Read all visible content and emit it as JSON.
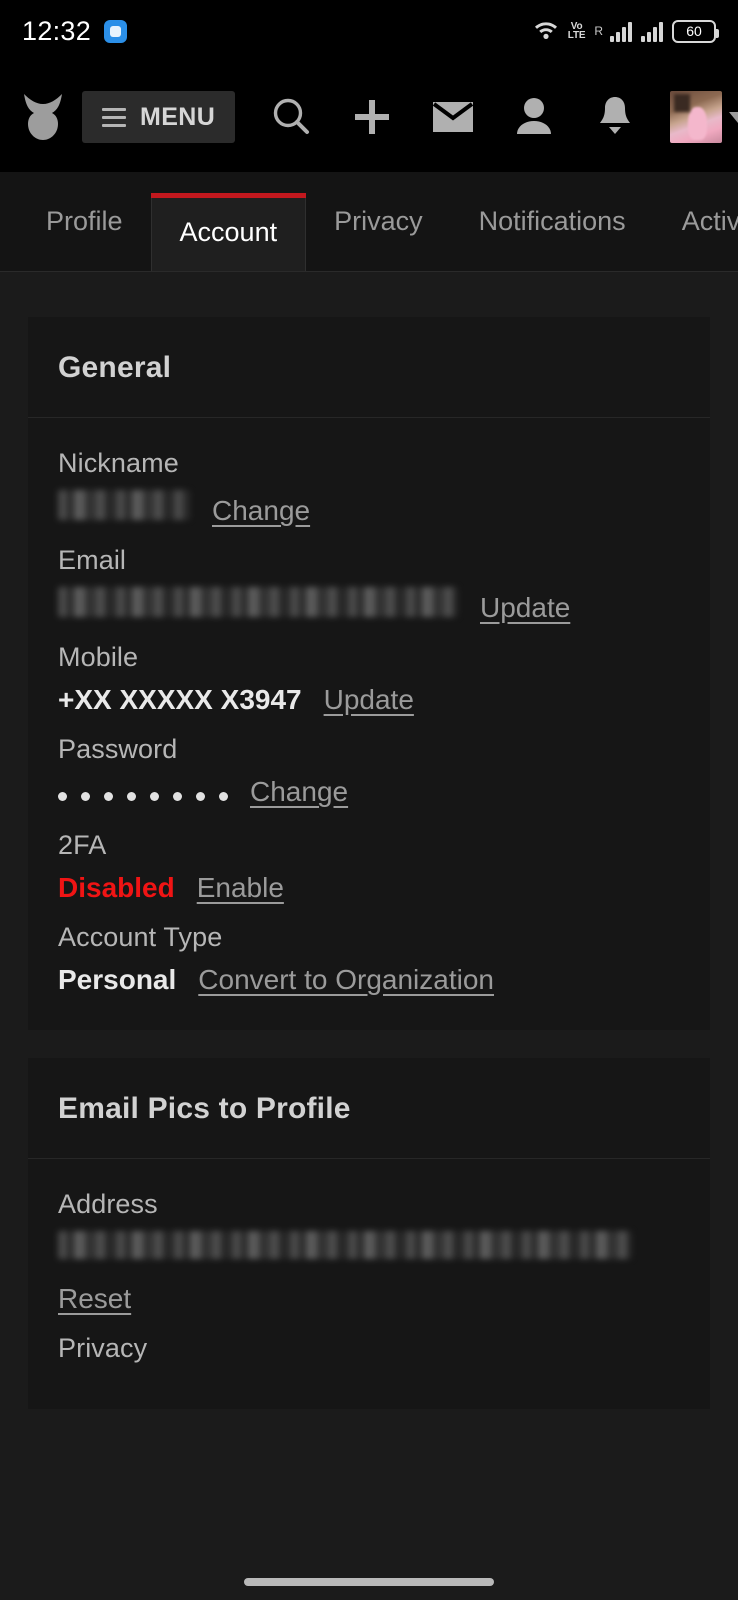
{
  "status_bar": {
    "time": "12:32",
    "app_badge_icon": "message-badge-icon",
    "wifi_icon": "wifi-icon",
    "volte_line1": "Vo",
    "volte_line2": "LTE",
    "roaming": "R",
    "signal_icon_1": "signal-bars-icon",
    "signal_icon_2": "signal-bars-icon",
    "battery_level": "60"
  },
  "toolbar": {
    "logo_icon": "fox-head-logo-icon",
    "menu_label": "MENU",
    "hamburger_icon": "hamburger-icon",
    "search_icon": "search-icon",
    "add_icon": "plus-icon",
    "mail_icon": "envelope-icon",
    "people_icon": "person-icon",
    "notifications_icon": "bell-icon",
    "avatar_icon": "avatar",
    "avatar_caret_icon": "chevron-down-icon"
  },
  "tabs": [
    {
      "label": "Profile",
      "active": false
    },
    {
      "label": "Account",
      "active": true
    },
    {
      "label": "Privacy",
      "active": false
    },
    {
      "label": "Notifications",
      "active": false
    },
    {
      "label": "Activi",
      "active": false
    }
  ],
  "accent_colors": {
    "active_tab_underline": "#c2181e",
    "status_danger": "#f01414",
    "link": "#9b9b9b",
    "page_bg": "#1b1b1b",
    "card_bg": "#161616"
  },
  "sections": [
    {
      "title": "General",
      "fields": [
        {
          "label": "Nickname",
          "value": "",
          "redacted": true,
          "link": "Change"
        },
        {
          "label": "Email",
          "value": "",
          "redacted": true,
          "link": "Update"
        },
        {
          "label": "Mobile",
          "value": "+XX XXXXX X3947",
          "redacted": false,
          "link": "Update"
        },
        {
          "label": "Password",
          "value": "••••••••",
          "redacted": false,
          "link": "Change"
        },
        {
          "label": "2FA",
          "value": "Disabled",
          "redacted": false,
          "link": "Enable",
          "danger": true
        },
        {
          "label": "Account Type",
          "value": "Personal",
          "redacted": false,
          "link": "Convert to Organization"
        }
      ]
    },
    {
      "title": "Email Pics to Profile",
      "fields": [
        {
          "label": "Address",
          "value": "",
          "redacted": true,
          "link": "Reset"
        },
        {
          "label": "Privacy",
          "value": "",
          "redacted": false,
          "link": ""
        }
      ]
    }
  ]
}
